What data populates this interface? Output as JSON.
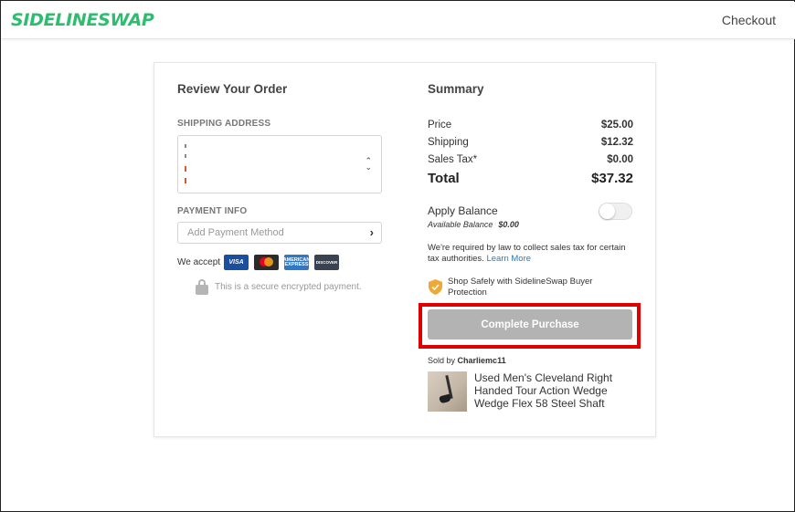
{
  "header": {
    "logo": "SIDELINESWAP",
    "checkout_link": "Checkout"
  },
  "review": {
    "title": "Review Your Order",
    "shipping_label": "SHIPPING ADDRESS",
    "payment_label": "PAYMENT INFO",
    "payment_placeholder": "Add Payment Method",
    "we_accept": "We accept",
    "cards": [
      "VISA",
      "mastercard",
      "AMERICAN EXPRESS",
      "DISCOVER"
    ],
    "secure_text": "This is a secure encrypted payment."
  },
  "summary": {
    "title": "Summary",
    "price_label": "Price",
    "price_value": "$25.00",
    "shipping_label": "Shipping",
    "shipping_value": "$12.32",
    "tax_label": "Sales Tax*",
    "tax_value": "$0.00",
    "total_label": "Total",
    "total_value": "$37.32",
    "balance_label": "Apply Balance",
    "balance_sub_label": "Available Balance",
    "balance_sub_value": "$0.00",
    "balance_toggle_on": false,
    "tax_note": "We're required by law to collect sales tax for certain tax authorities.",
    "learn_more": "Learn More",
    "protection_text": "Shop Safely with SidelineSwap Buyer Protection",
    "purchase_button": "Complete Purchase",
    "sold_by_prefix": "Sold by",
    "seller": "Charliemc11",
    "product_title": "Used Men's Cleveland Right Handed Tour Action Wedge Wedge Flex 58 Steel Shaft"
  },
  "colors": {
    "brand_green": "#2dbd6e",
    "button_disabled": "#b3b3b3",
    "link_blue": "#2a7ab8",
    "highlight_red": "#e00000"
  },
  "icons": {
    "select_caret": "chevron-up-down-icon",
    "payment_chevron": "chevron-right-icon",
    "secure": "lock-icon",
    "protection": "shield-check-icon"
  }
}
